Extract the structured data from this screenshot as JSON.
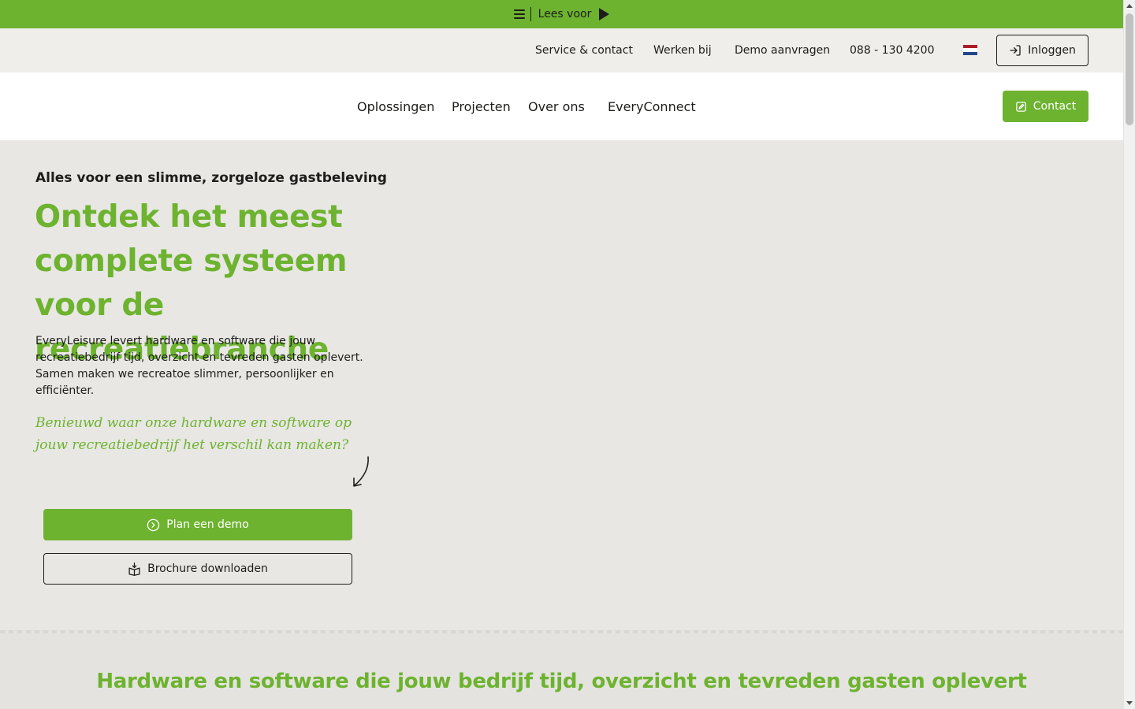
{
  "readbar": {
    "label": "Lees voor"
  },
  "utility_nav": {
    "service": "Service & contact",
    "jobs": "Werken bij",
    "demo": "Demo aanvragen",
    "phone": "088 - 130 4200",
    "login": "Inloggen"
  },
  "main_nav": {
    "items": [
      "Oplossingen",
      "Projecten",
      "Over ons",
      "EveryConnect"
    ],
    "contact": "Contact"
  },
  "hero": {
    "eyebrow": "Alles voor een slimme, zorgeloze gastbeleving",
    "title": "Ontdek het meest complete systeem voor de recreatiebranche",
    "text": "EveryLeisure levert hardware en software die jouw recreatiebedrijf tijd, overzicht en tevreden gasten oplevert. Samen maken we recreatoe slimmer, persoonlijker en efficiënter.",
    "handwritten": "Benieuwd waar onze hardware en software op jouw recreatiebedrijf het verschil kan maken?",
    "demo_button": "Plan een demo",
    "brochure_button": "Brochure downloaden"
  },
  "section2": {
    "title": "Hardware en software die jouw bedrijf tijd, overzicht en tevreden gasten oplevert"
  },
  "colors": {
    "brand_green": "#6db32f",
    "hero_bg": "#e8e7e4",
    "utility_bg": "#efeeeb",
    "flag": [
      "#ae1c28",
      "#ffffff",
      "#21468b"
    ]
  }
}
